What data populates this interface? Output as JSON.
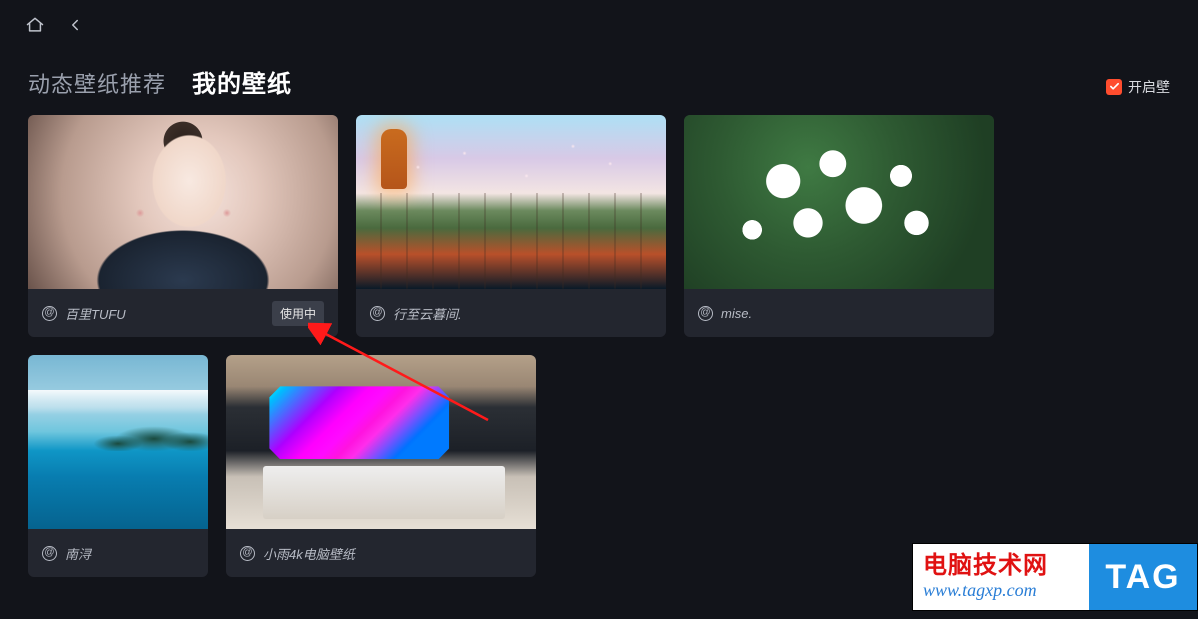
{
  "tabs": {
    "recommend": "动态壁纸推荐",
    "mine": "我的壁纸"
  },
  "toggle": {
    "label": "开启壁"
  },
  "wallpapers": [
    {
      "author": "百里TUFU",
      "badge": "使用中"
    },
    {
      "author": "行至云暮间."
    },
    {
      "author": "mise."
    },
    {
      "author": "南浔"
    },
    {
      "author": "小雨4k电脑壁纸"
    }
  ],
  "watermark": {
    "title": "电脑技术网",
    "url": "www.tagxp.com",
    "tag": "TAG"
  }
}
